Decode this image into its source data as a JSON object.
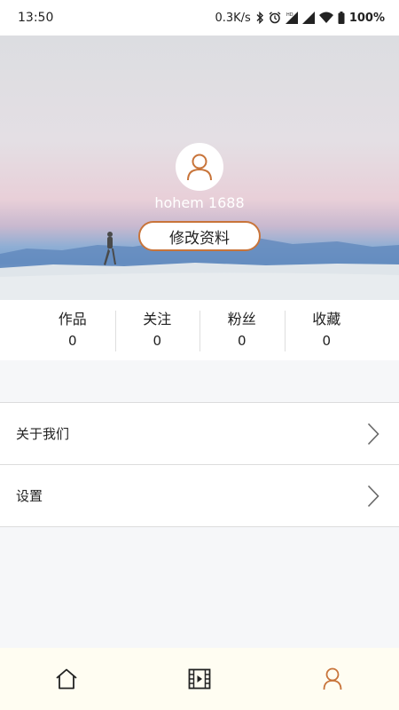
{
  "status_bar": {
    "time": "13:50",
    "network_speed": "0.3K/s",
    "battery": "100%",
    "icons": [
      "bluetooth-icon",
      "alarm-icon",
      "hd-signal-icon",
      "cell-signal-icon",
      "wifi-icon",
      "battery-icon"
    ]
  },
  "profile": {
    "username": "hohem 1688",
    "edit_label": "修改资料",
    "accent_color": "#c8743a"
  },
  "stats": [
    {
      "label": "作品",
      "count": "0"
    },
    {
      "label": "关注",
      "count": "0"
    },
    {
      "label": "粉丝",
      "count": "0"
    },
    {
      "label": "收藏",
      "count": "0"
    }
  ],
  "menu": [
    {
      "label": "关于我们",
      "icon": "chevron-right-icon"
    },
    {
      "label": "设置",
      "icon": "chevron-right-icon"
    }
  ],
  "bottom_nav": [
    {
      "name": "home",
      "icon": "home-icon",
      "active": false
    },
    {
      "name": "video",
      "icon": "film-icon",
      "active": false
    },
    {
      "name": "profile",
      "icon": "user-icon",
      "active": true
    }
  ]
}
